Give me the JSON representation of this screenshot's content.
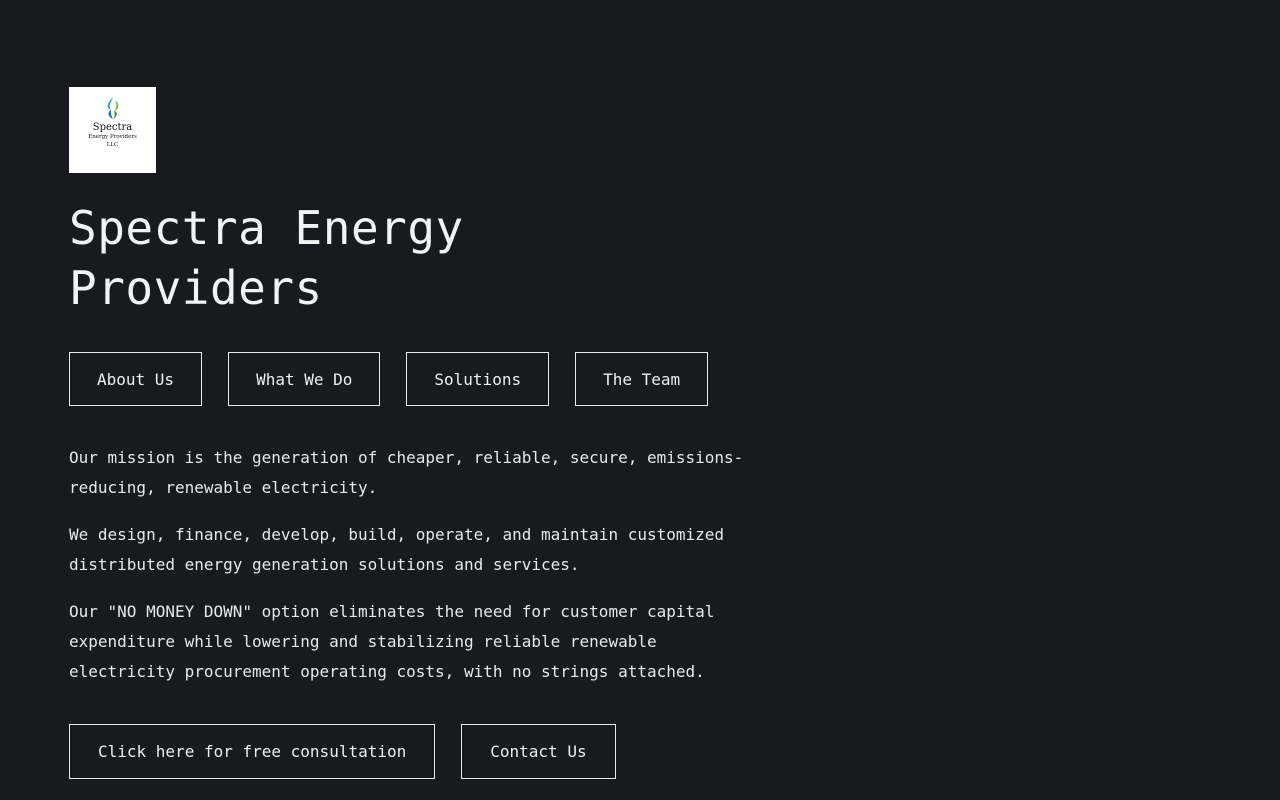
{
  "logo": {
    "name": "Spectra",
    "subtitle_line1": "Energy Providers",
    "subtitle_line2": "LLC"
  },
  "header": {
    "title": "Spectra Energy Providers"
  },
  "nav": {
    "items": [
      {
        "label": "About Us"
      },
      {
        "label": "What We Do"
      },
      {
        "label": "Solutions"
      },
      {
        "label": "The Team"
      }
    ]
  },
  "main": {
    "paragraphs": [
      "Our mission is the generation of cheaper, reliable, secure, emissions-reducing, renewable electricity.",
      "We design, finance, develop, build, operate, and maintain customized distributed energy generation solutions and services.",
      "Our \"NO MONEY DOWN\" option eliminates the need for customer capital expenditure while lowering and stabilizing reliable renewable electricity procurement operating costs, with no strings attached."
    ]
  },
  "cta": {
    "consultation_label": "Click here for free consultation",
    "contact_label": "Contact Us"
  },
  "colors": {
    "background": "#181a20",
    "text": "#eceef2",
    "border": "#e8eaee"
  }
}
